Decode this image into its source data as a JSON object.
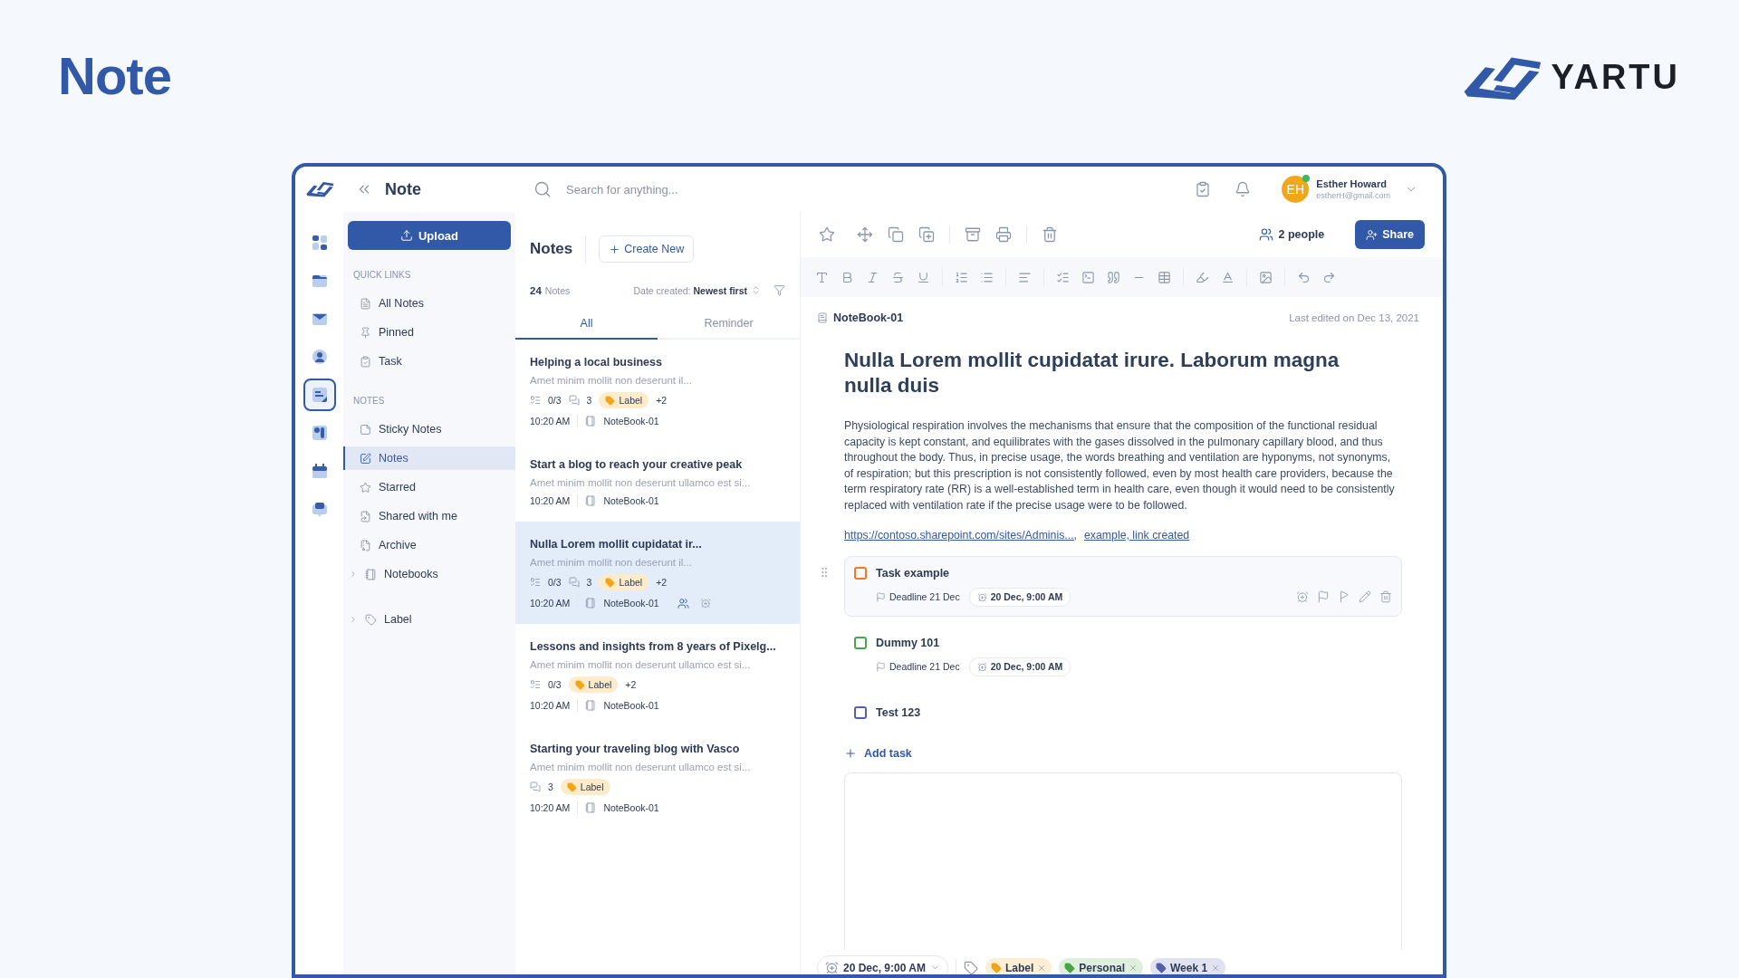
{
  "page": {
    "title": "Note",
    "brand": "YARTU"
  },
  "app": {
    "title": "Note",
    "search": {
      "placeholder": "Search for anything..."
    },
    "user": {
      "initials": "EH",
      "name": "Esther Howard",
      "email": "estherH@gmail.com",
      "online": true
    }
  },
  "rail": [
    {
      "selected": false
    },
    {
      "selected": false
    },
    {
      "selected": false
    },
    {
      "selected": false
    },
    {
      "selected": true
    },
    {
      "selected": false
    },
    {
      "selected": false
    },
    {
      "selected": false
    }
  ],
  "sidebar": {
    "upload": "Upload",
    "sections": [
      {
        "title": "QUICK LINKS",
        "items": [
          {
            "label": "All Notes",
            "selected": false
          },
          {
            "label": "Pinned",
            "selected": false
          },
          {
            "label": "Task",
            "selected": false
          }
        ]
      },
      {
        "title": "NOTES",
        "items": [
          {
            "label": "Sticky Notes",
            "selected": false
          },
          {
            "label": "Notes",
            "selected": true
          },
          {
            "label": "Starred",
            "selected": false
          },
          {
            "label": "Shared with me",
            "selected": false
          },
          {
            "label": "Archive",
            "selected": false
          },
          {
            "label": "Notebooks",
            "selected": false,
            "expanded": false
          }
        ]
      },
      {
        "items": [
          {
            "label": "Label",
            "selected": false,
            "expanded": false
          }
        ]
      }
    ]
  },
  "notes_list": {
    "title": "Notes",
    "create": "Create New",
    "count": "24",
    "count_label": "Notes",
    "sort_label": "Date created:",
    "sort_value": "Newest first",
    "tabs": [
      {
        "label": "All",
        "selected": true
      },
      {
        "label": "Reminder",
        "selected": false
      }
    ],
    "notes": [
      {
        "title": "Helping a local business",
        "preview": "Amet minim mollit non deserunt il...",
        "tasks": "0/3",
        "comments": "3",
        "label": "Label",
        "extra": "+2",
        "time": "10:20 AM",
        "notebook": "NoteBook-01",
        "selected": false,
        "shared": false,
        "reminder": false
      },
      {
        "title": "Start a blog to reach your creative peak",
        "preview": "Amet minim mollit non deserunt ullamco est si...",
        "time": "10:20 AM",
        "notebook": "NoteBook-01",
        "selected": false,
        "shared": false,
        "reminder": false
      },
      {
        "title": "Nulla Lorem mollit cupidatat ir...",
        "preview": "Amet minim mollit non deserunt il...",
        "tasks": "0/3",
        "comments": "3",
        "label": "Label",
        "extra": "+2",
        "time": "10:20 AM",
        "notebook": "NoteBook-01",
        "selected": true,
        "shared": true,
        "reminder": true
      },
      {
        "title": "Lessons and insights from 8 years of Pixelg...",
        "preview": "Amet minim mollit non deserunt ullamco est si...",
        "tasks": "0/3",
        "label": "Label",
        "extra": "+2",
        "time": "10:20 AM",
        "notebook": "NoteBook-01",
        "selected": false,
        "shared": false,
        "reminder": false
      },
      {
        "title": "Starting your traveling blog with Vasco",
        "preview": "Amet minim mollit non deserunt ullamco est si...",
        "comments": "3",
        "label": "Label",
        "time": "10:20 AM",
        "notebook": "NoteBook-01",
        "selected": false,
        "shared": false,
        "reminder": false
      }
    ]
  },
  "editor": {
    "people": "2 people",
    "share": "Share",
    "notebook": "NoteBook-01",
    "last_edited": "Last edited on Dec 13, 2021",
    "title": "Nulla Lorem mollit cupidatat irure. Laborum magna nulla duis",
    "body": "Physiological respiration involves the mechanisms that ensure that the composition of the functional residual capacity is kept constant, and equilibrates with the gases dissolved in the pulmonary capillary blood, and thus throughout the body. Thus, in precise usage, the words breathing and ventilation are hyponyms, not synonyms, of respiration; but this prescription is not consistently followed, even by most health care providers, because the term respiratory rate (RR) is a well-established term in health care, even though it would need to be consistently replaced with ventilation rate if the precise usage were to be followed.",
    "links": [
      "https://contoso.sharepoint.com/sites/Adminis...,",
      "example, link created"
    ],
    "tasks": [
      {
        "title": "Task example",
        "color": "#f07a22",
        "checked": false,
        "active": true,
        "deadline": "Deadline 21 Dec",
        "reminder": "20 Dec, 9:00 AM"
      },
      {
        "title": "Dummy 101",
        "color": "#45a84a",
        "checked": false,
        "active": false,
        "deadline": "Deadline 21 Dec",
        "reminder": "20 Dec, 9:00 AM"
      },
      {
        "title": "Test 123",
        "color": "#5360ad",
        "checked": false,
        "active": false
      }
    ],
    "add_task": "Add task",
    "reminder": "20 Dec, 9:00 AM",
    "tags": [
      {
        "label": "Label",
        "color": "#f2a516"
      },
      {
        "label": "Personal",
        "color": "#47a548"
      },
      {
        "label": "Week 1",
        "color": "#5360ad"
      }
    ]
  }
}
